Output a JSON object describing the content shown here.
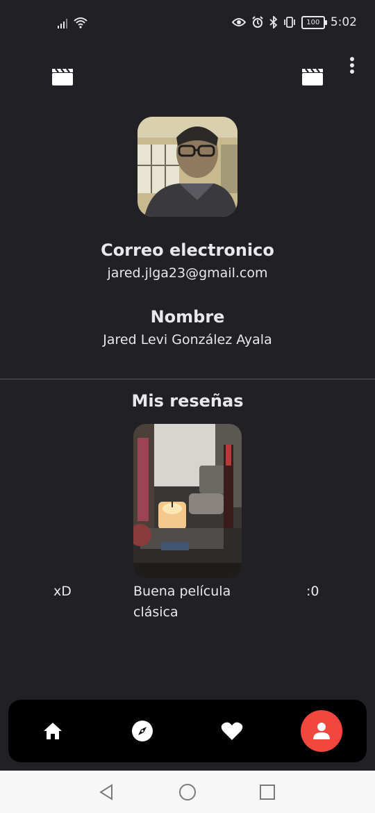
{
  "status_bar": {
    "time": "5:02",
    "battery": "100",
    "icons": [
      "signal-icon",
      "wifi-icon",
      "eye-icon",
      "alarm-icon",
      "bluetooth-icon",
      "vibrate-icon",
      "battery-icon"
    ]
  },
  "header": {
    "menu_icon": "more-vert-icon"
  },
  "profile": {
    "email_label": "Correo electronico",
    "email": "jared.jlga23@gmail.com",
    "name_label": "Nombre",
    "name": "Jared Levi González Ayala"
  },
  "reviews": {
    "title": "Mis reseñas",
    "items": [
      {
        "caption": "xD",
        "thumbnail": "movie-clapper-icon"
      },
      {
        "caption": "Buena película clásica",
        "thumbnail": "photo"
      },
      {
        "caption": ":0",
        "thumbnail": "movie-clapper-icon"
      }
    ]
  },
  "bottom_nav": {
    "items": [
      {
        "icon": "home-icon",
        "active": false
      },
      {
        "icon": "explore-icon",
        "active": false
      },
      {
        "icon": "heart-icon",
        "active": false
      },
      {
        "icon": "person-icon",
        "active": true
      }
    ],
    "active_color": "#f2473e"
  },
  "system_nav": {
    "icons": [
      "back-icon",
      "home-circle-icon",
      "recents-icon"
    ]
  },
  "colors": {
    "background": "#212025",
    "text": "#e9e8ec",
    "accent": "#f2473e"
  }
}
